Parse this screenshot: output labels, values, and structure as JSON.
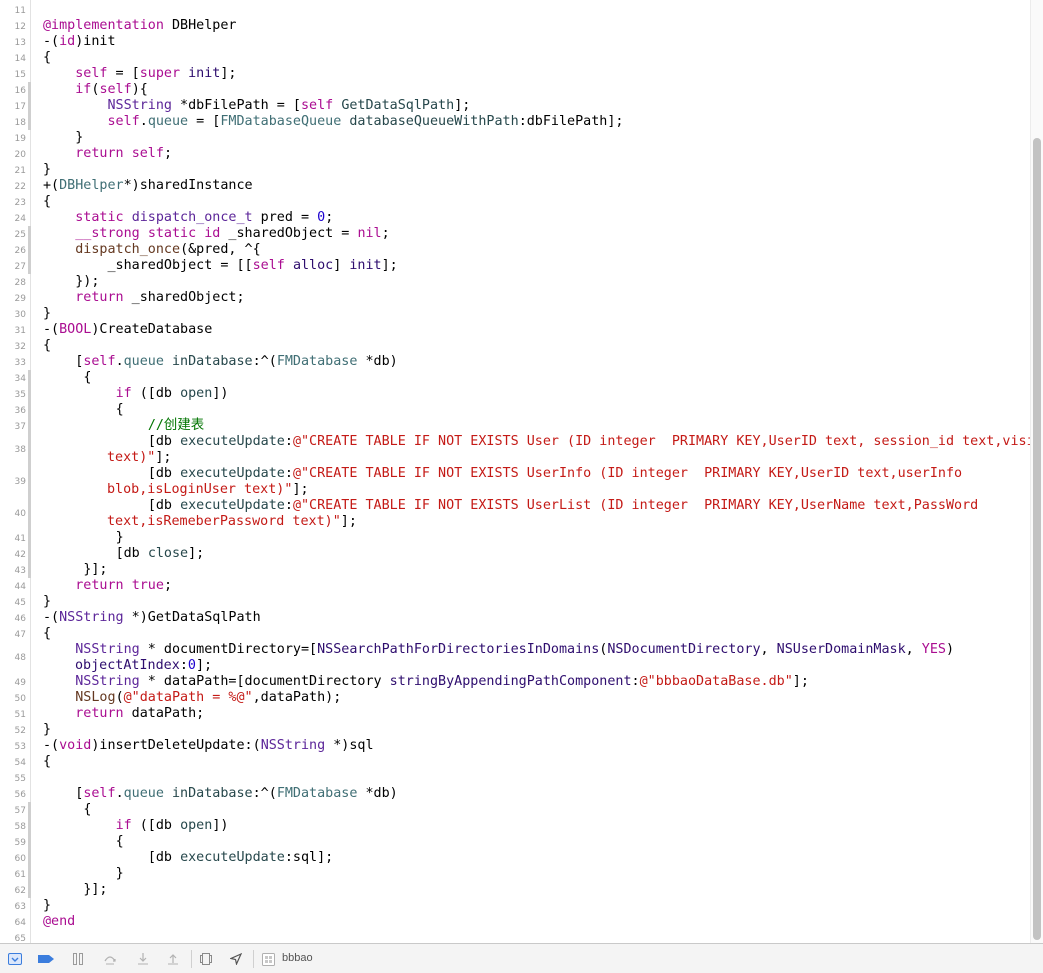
{
  "editor": {
    "lines": [
      {
        "n": "11",
        "tokens": []
      },
      {
        "n": "12",
        "tokens": [
          {
            "c": "kw",
            "t": "@implementation"
          },
          {
            "t": " DBHelper"
          }
        ]
      },
      {
        "n": "13",
        "tokens": [
          {
            "t": "-("
          },
          {
            "c": "kw",
            "t": "id"
          },
          {
            "t": ")init"
          }
        ]
      },
      {
        "n": "14",
        "tokens": [
          {
            "t": "{"
          }
        ]
      },
      {
        "n": "15",
        "tokens": [
          {
            "t": "    "
          },
          {
            "c": "kw",
            "t": "self"
          },
          {
            "t": " = ["
          },
          {
            "c": "kw",
            "t": "super"
          },
          {
            "t": " "
          },
          {
            "c": "fn",
            "t": "init"
          },
          {
            "t": "];"
          }
        ]
      },
      {
        "n": "16",
        "tokens": [
          {
            "t": "    "
          },
          {
            "c": "kw",
            "t": "if"
          },
          {
            "t": "("
          },
          {
            "c": "kw",
            "t": "self"
          },
          {
            "t": "){"
          }
        ],
        "mark": true
      },
      {
        "n": "17",
        "tokens": [
          {
            "t": "        "
          },
          {
            "c": "cls",
            "t": "NSString"
          },
          {
            "t": " *dbFilePath = ["
          },
          {
            "c": "kw",
            "t": "self"
          },
          {
            "t": " "
          },
          {
            "c": "mth",
            "t": "GetDataSqlPath"
          },
          {
            "t": "];"
          }
        ],
        "mark": true
      },
      {
        "n": "18",
        "tokens": [
          {
            "t": "        "
          },
          {
            "c": "kw",
            "t": "self"
          },
          {
            "t": "."
          },
          {
            "c": "prj",
            "t": "queue"
          },
          {
            "t": " = ["
          },
          {
            "c": "prj",
            "t": "FMDatabaseQueue"
          },
          {
            "t": " "
          },
          {
            "c": "mth",
            "t": "databaseQueueWithPath"
          },
          {
            "t": ":dbFilePath];"
          }
        ],
        "mark": true
      },
      {
        "n": "19",
        "tokens": [
          {
            "t": "    }"
          }
        ]
      },
      {
        "n": "20",
        "tokens": [
          {
            "t": "    "
          },
          {
            "c": "kw",
            "t": "return"
          },
          {
            "t": " "
          },
          {
            "c": "kw",
            "t": "self"
          },
          {
            "t": ";"
          }
        ]
      },
      {
        "n": "21",
        "tokens": [
          {
            "t": "}"
          }
        ]
      },
      {
        "n": "22",
        "tokens": [
          {
            "t": "+("
          },
          {
            "c": "prj",
            "t": "DBHelper"
          },
          {
            "t": "*)sharedInstance"
          }
        ]
      },
      {
        "n": "23",
        "tokens": [
          {
            "t": "{"
          }
        ]
      },
      {
        "n": "24",
        "tokens": [
          {
            "t": "    "
          },
          {
            "c": "kw",
            "t": "static"
          },
          {
            "t": " "
          },
          {
            "c": "cls",
            "t": "dispatch_once_t"
          },
          {
            "t": " pred = "
          },
          {
            "c": "num",
            "t": "0"
          },
          {
            "t": ";"
          }
        ]
      },
      {
        "n": "25",
        "tokens": [
          {
            "t": "    "
          },
          {
            "c": "kw",
            "t": "__strong"
          },
          {
            "t": " "
          },
          {
            "c": "kw",
            "t": "static"
          },
          {
            "t": " "
          },
          {
            "c": "kw",
            "t": "id"
          },
          {
            "t": " _sharedObject = "
          },
          {
            "c": "kw",
            "t": "nil"
          },
          {
            "t": ";"
          }
        ],
        "mark": true
      },
      {
        "n": "26",
        "tokens": [
          {
            "t": "    "
          },
          {
            "c": "mac",
            "t": "dispatch_once"
          },
          {
            "t": "(&pred, ^{"
          }
        ],
        "mark": true
      },
      {
        "n": "27",
        "tokens": [
          {
            "t": "        _sharedObject = [["
          },
          {
            "c": "kw",
            "t": "self"
          },
          {
            "t": " "
          },
          {
            "c": "fn",
            "t": "alloc"
          },
          {
            "t": "] "
          },
          {
            "c": "fn",
            "t": "init"
          },
          {
            "t": "];"
          }
        ],
        "mark": true
      },
      {
        "n": "28",
        "tokens": [
          {
            "t": "    });"
          }
        ]
      },
      {
        "n": "29",
        "tokens": [
          {
            "t": "    "
          },
          {
            "c": "kw",
            "t": "return"
          },
          {
            "t": " _sharedObject;"
          }
        ]
      },
      {
        "n": "30",
        "tokens": [
          {
            "t": "}"
          }
        ]
      },
      {
        "n": "31",
        "tokens": [
          {
            "t": "-("
          },
          {
            "c": "kw",
            "t": "BOOL"
          },
          {
            "t": ")CreateDatabase"
          }
        ]
      },
      {
        "n": "32",
        "tokens": [
          {
            "t": "{"
          }
        ]
      },
      {
        "n": "33",
        "tokens": [
          {
            "t": "    ["
          },
          {
            "c": "kw",
            "t": "self"
          },
          {
            "t": "."
          },
          {
            "c": "prj",
            "t": "queue"
          },
          {
            "t": " "
          },
          {
            "c": "mth",
            "t": "inDatabase"
          },
          {
            "t": ":^("
          },
          {
            "c": "prj",
            "t": "FMDatabase"
          },
          {
            "t": " *db)"
          }
        ]
      },
      {
        "n": "34",
        "tokens": [
          {
            "t": "     {"
          }
        ],
        "mark": true
      },
      {
        "n": "35",
        "tokens": [
          {
            "t": "         "
          },
          {
            "c": "kw",
            "t": "if"
          },
          {
            "t": " ([db "
          },
          {
            "c": "mth",
            "t": "open"
          },
          {
            "t": "])"
          }
        ],
        "mark": true
      },
      {
        "n": "36",
        "tokens": [
          {
            "t": "         {"
          }
        ],
        "mark": true
      },
      {
        "n": "37",
        "tokens": [
          {
            "t": "             "
          },
          {
            "c": "cmt",
            "t": "//创建表"
          }
        ],
        "mark": true
      },
      {
        "n": "38",
        "wrap": true,
        "tokens": [
          {
            "t": "             [db "
          },
          {
            "c": "mth",
            "t": "executeUpdate"
          },
          {
            "t": ":"
          },
          {
            "c": "str",
            "t": "@\"CREATE TABLE IF NOT EXISTS User (ID integer  PRIMARY KEY,UserID text, session_id text,visitor_id text)\""
          },
          {
            "t": "];"
          }
        ],
        "mark": true
      },
      {
        "n": "39",
        "wrap": true,
        "tokens": [
          {
            "t": "             [db "
          },
          {
            "c": "mth",
            "t": "executeUpdate"
          },
          {
            "t": ":"
          },
          {
            "c": "str",
            "t": "@\"CREATE TABLE IF NOT EXISTS UserInfo (ID integer  PRIMARY KEY,UserID text,userInfo blob,isLoginUser text)\""
          },
          {
            "t": "];"
          }
        ],
        "mark": true
      },
      {
        "n": "40",
        "wrap": true,
        "tokens": [
          {
            "t": "             [db "
          },
          {
            "c": "mth",
            "t": "executeUpdate"
          },
          {
            "t": ":"
          },
          {
            "c": "str",
            "t": "@\"CREATE TABLE IF NOT EXISTS UserList (ID integer  PRIMARY KEY,UserName text,PassWord text,isRemeberPassword text)\""
          },
          {
            "t": "];"
          }
        ],
        "mark": true
      },
      {
        "n": "41",
        "tokens": [
          {
            "t": "         }"
          }
        ],
        "mark": true
      },
      {
        "n": "42",
        "tokens": [
          {
            "t": "         [db "
          },
          {
            "c": "mth",
            "t": "close"
          },
          {
            "t": "];"
          }
        ],
        "mark": true
      },
      {
        "n": "43",
        "tokens": [
          {
            "t": "     }];"
          }
        ],
        "mark": true
      },
      {
        "n": "44",
        "tokens": [
          {
            "t": "    "
          },
          {
            "c": "kw",
            "t": "return"
          },
          {
            "t": " "
          },
          {
            "c": "kw",
            "t": "true"
          },
          {
            "t": ";"
          }
        ]
      },
      {
        "n": "45",
        "tokens": [
          {
            "t": "}"
          }
        ]
      },
      {
        "n": "46",
        "tokens": [
          {
            "t": "-("
          },
          {
            "c": "cls",
            "t": "NSString"
          },
          {
            "t": " *)GetDataSqlPath"
          }
        ]
      },
      {
        "n": "47",
        "tokens": [
          {
            "t": "{"
          }
        ]
      },
      {
        "n": "48",
        "wrap2": true,
        "tokens": [
          {
            "t": "    "
          },
          {
            "c": "cls",
            "t": "NSString"
          },
          {
            "t": " * documentDirectory=["
          },
          {
            "c": "fn",
            "t": "NSSearchPathForDirectoriesInDomains"
          },
          {
            "t": "("
          },
          {
            "c": "fn",
            "t": "NSDocumentDirectory"
          },
          {
            "t": ", "
          },
          {
            "c": "fn",
            "t": "NSUserDomainMask"
          },
          {
            "t": ", "
          },
          {
            "c": "kw",
            "t": "YES"
          },
          {
            "t": ") "
          },
          {
            "c": "fn",
            "t": "objectAtIndex"
          },
          {
            "t": ":"
          },
          {
            "c": "num",
            "t": "0"
          },
          {
            "t": "];"
          }
        ]
      },
      {
        "n": "49",
        "tokens": [
          {
            "t": "    "
          },
          {
            "c": "cls",
            "t": "NSString"
          },
          {
            "t": " * dataPath=[documentDirectory "
          },
          {
            "c": "fn",
            "t": "stringByAppendingPathComponent"
          },
          {
            "t": ":"
          },
          {
            "c": "str",
            "t": "@\"bbbaoDataBase.db\""
          },
          {
            "t": "];"
          }
        ]
      },
      {
        "n": "50",
        "tokens": [
          {
            "t": "    "
          },
          {
            "c": "mac",
            "t": "NSLog"
          },
          {
            "t": "("
          },
          {
            "c": "str",
            "t": "@\"dataPath = %@\""
          },
          {
            "t": ",dataPath);"
          }
        ]
      },
      {
        "n": "51",
        "tokens": [
          {
            "t": "    "
          },
          {
            "c": "kw",
            "t": "return"
          },
          {
            "t": " dataPath;"
          }
        ]
      },
      {
        "n": "52",
        "tokens": [
          {
            "t": "}"
          }
        ]
      },
      {
        "n": "53",
        "tokens": [
          {
            "t": "-("
          },
          {
            "c": "kw",
            "t": "void"
          },
          {
            "t": ")insertDeleteUpdate:("
          },
          {
            "c": "cls",
            "t": "NSString"
          },
          {
            "t": " *)sql"
          }
        ]
      },
      {
        "n": "54",
        "tokens": [
          {
            "t": "{"
          }
        ]
      },
      {
        "n": "55",
        "tokens": []
      },
      {
        "n": "56",
        "tokens": [
          {
            "t": "    ["
          },
          {
            "c": "kw",
            "t": "self"
          },
          {
            "t": "."
          },
          {
            "c": "prj",
            "t": "queue"
          },
          {
            "t": " "
          },
          {
            "c": "mth",
            "t": "inDatabase"
          },
          {
            "t": ":^("
          },
          {
            "c": "prj",
            "t": "FMDatabase"
          },
          {
            "t": " *db)"
          }
        ]
      },
      {
        "n": "57",
        "tokens": [
          {
            "t": "     {"
          }
        ],
        "mark": true
      },
      {
        "n": "58",
        "tokens": [
          {
            "t": "         "
          },
          {
            "c": "kw",
            "t": "if"
          },
          {
            "t": " ([db "
          },
          {
            "c": "mth",
            "t": "open"
          },
          {
            "t": "])"
          }
        ],
        "mark": true
      },
      {
        "n": "59",
        "tokens": [
          {
            "t": "         {"
          }
        ],
        "mark": true
      },
      {
        "n": "60",
        "tokens": [
          {
            "t": "             [db "
          },
          {
            "c": "mth",
            "t": "executeUpdate"
          },
          {
            "t": ":sql];"
          }
        ],
        "mark": true
      },
      {
        "n": "61",
        "tokens": [
          {
            "t": "         }"
          }
        ],
        "mark": true
      },
      {
        "n": "62",
        "tokens": [
          {
            "t": "     }];"
          }
        ],
        "mark": true
      },
      {
        "n": "63",
        "tokens": [
          {
            "t": "}"
          }
        ]
      },
      {
        "n": "64",
        "tokens": [
          {
            "c": "kw",
            "t": "@end"
          }
        ]
      },
      {
        "n": "65",
        "tokens": []
      }
    ]
  },
  "debug_bar": {
    "target_name": "bbbao",
    "icons": [
      "hide-debug-area-icon",
      "breakpoints-toggle-icon",
      "pause-icon",
      "step-over-icon",
      "step-into-icon",
      "step-out-icon",
      "view-debugger-icon",
      "location-icon",
      "target-icon"
    ]
  },
  "colors": {
    "keyword": "#aa0d91",
    "string": "#c41a16",
    "number": "#1c00cf",
    "class": "#5c2699",
    "project": "#3f6e74",
    "comment": "#007400",
    "accent": "#3b7ddd"
  }
}
